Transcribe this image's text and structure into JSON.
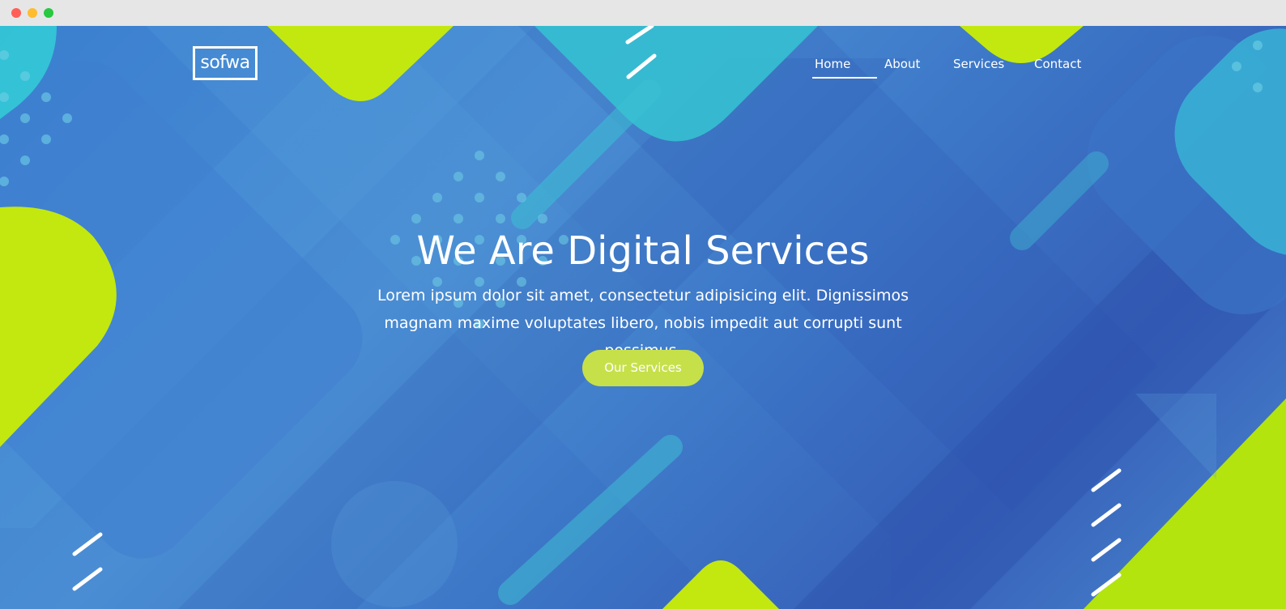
{
  "brand": {
    "logo_text": "sofwa"
  },
  "nav": {
    "items": [
      {
        "label": "Home",
        "active": true
      },
      {
        "label": "About",
        "active": false
      },
      {
        "label": "Services",
        "active": false
      },
      {
        "label": "Contact",
        "active": false
      }
    ]
  },
  "hero": {
    "title": "We Are Digital Services",
    "subtitle": "Lorem ipsum dolor sit amet, consectetur adipisicing elit. Dignissimos magnam maxime voluptates libero, nobis impedit aut corrupti sunt possimus.",
    "cta_label": "Our Services"
  },
  "colors": {
    "background_blue": "#3a7fd0",
    "accent_lime": "#c6e04a",
    "shape_lime": "#c3e80f",
    "shape_cyan": "#33c6d1",
    "text": "#ffffff"
  }
}
